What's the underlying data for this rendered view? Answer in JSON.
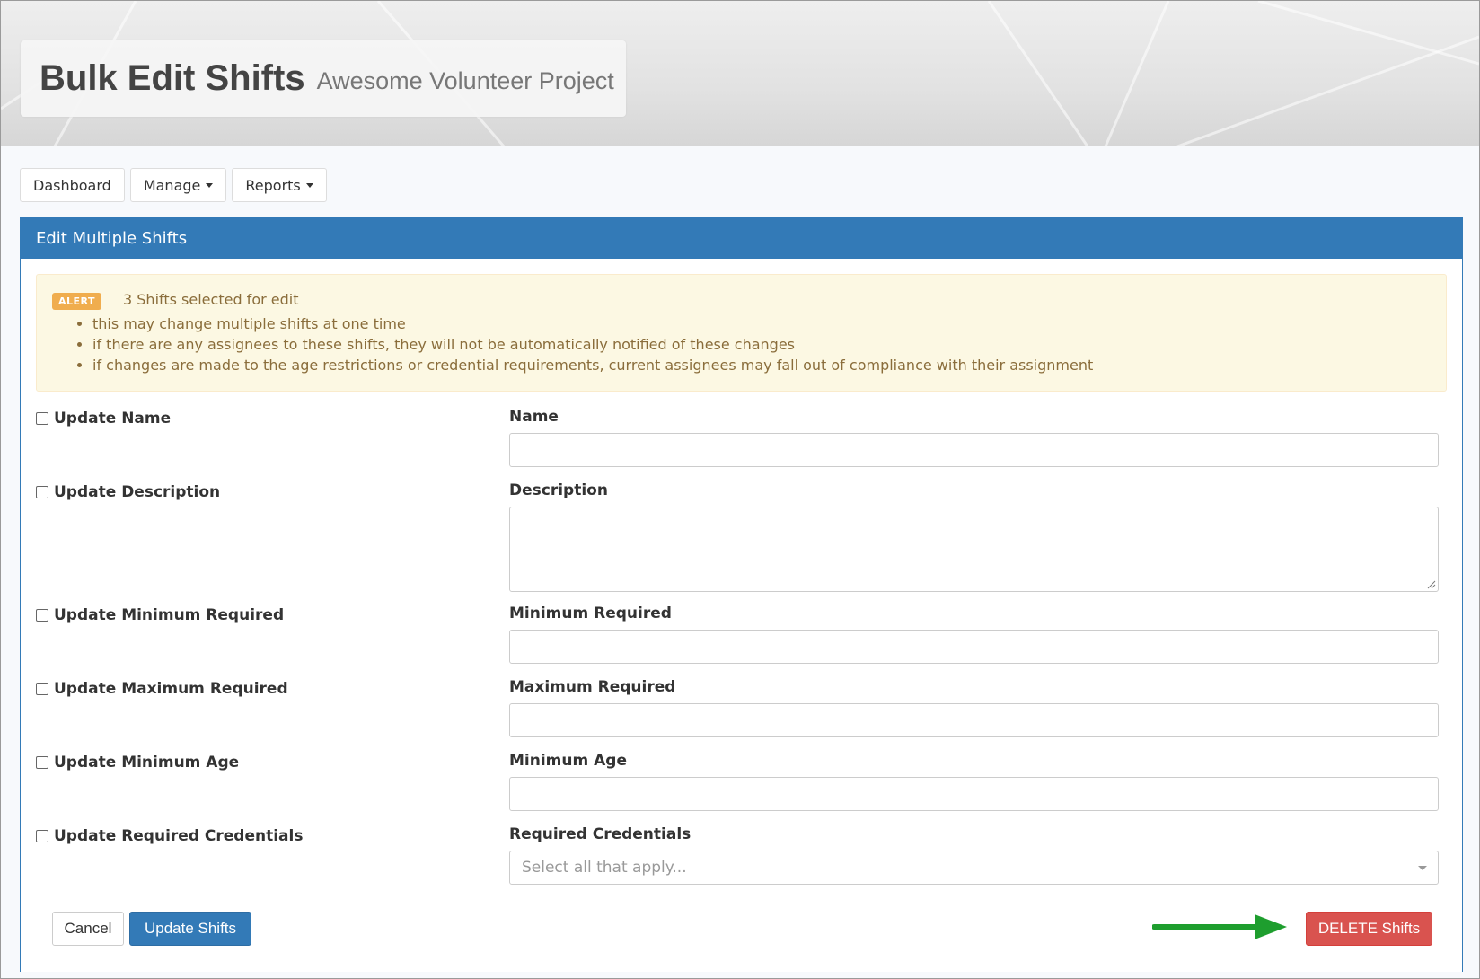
{
  "header": {
    "title": "Bulk Edit Shifts",
    "project": "Awesome Volunteer Project"
  },
  "nav": {
    "dashboard": "Dashboard",
    "manage": "Manage",
    "reports": "Reports"
  },
  "panel": {
    "heading": "Edit Multiple Shifts"
  },
  "alert": {
    "badge": "ALERT",
    "headline": "3 Shifts selected for edit",
    "bullets": [
      "this may change multiple shifts at one time",
      "if there are any assignees to these shifts, they will not be automatically notified of these changes",
      "if changes are made to the age restrictions or credential requirements, current assignees may fall out of compliance with their assignment"
    ]
  },
  "form": {
    "rows": [
      {
        "check_label": "Update Name",
        "field_label": "Name",
        "value": ""
      },
      {
        "check_label": "Update Description",
        "field_label": "Description",
        "value": ""
      },
      {
        "check_label": "Update Minimum Required",
        "field_label": "Minimum Required",
        "value": ""
      },
      {
        "check_label": "Update Maximum Required",
        "field_label": "Maximum Required",
        "value": ""
      },
      {
        "check_label": "Update Minimum Age",
        "field_label": "Minimum Age",
        "value": ""
      },
      {
        "check_label": "Update Required Credentials",
        "field_label": "Required Credentials",
        "placeholder": "Select all that apply..."
      }
    ]
  },
  "buttons": {
    "cancel": "Cancel",
    "update": "Update Shifts",
    "delete": "DELETE Shifts"
  },
  "colors": {
    "primary": "#337ab7",
    "danger": "#d9534f",
    "warning_badge": "#f0ad4e",
    "alert_bg": "#fcf8e3",
    "alert_text": "#8a6d3b",
    "annotation_arrow": "#1e9e2e"
  },
  "icons": {
    "dropdown": "caret-down-icon",
    "annotation": "arrow-right-icon"
  }
}
